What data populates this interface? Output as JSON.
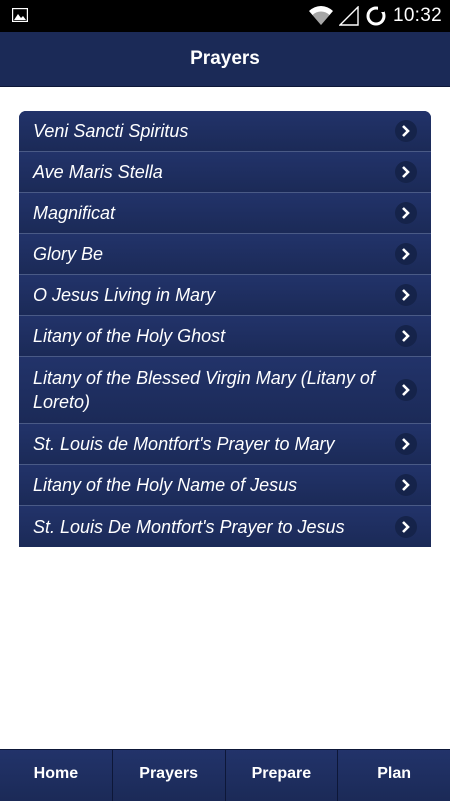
{
  "status_bar": {
    "time": "10:32",
    "icons": [
      "image-notification-icon",
      "wifi-icon",
      "signal-icon",
      "sync-icon"
    ]
  },
  "header": {
    "title": "Prayers"
  },
  "prayers": [
    {
      "label": "Veni Sancti Spiritus"
    },
    {
      "label": "Ave Maris Stella"
    },
    {
      "label": "Magnificat"
    },
    {
      "label": "Glory Be"
    },
    {
      "label": "O Jesus Living in Mary"
    },
    {
      "label": "Litany of the Holy Ghost"
    },
    {
      "label": "Litany of the Blessed Virgin Mary (Litany of Loreto)"
    },
    {
      "label": "St. Louis de Montfort's Prayer to Mary"
    },
    {
      "label": "Litany of the Holy Name of Jesus"
    },
    {
      "label": "St. Louis De Montfort's Prayer to Jesus"
    }
  ],
  "nav": {
    "items": [
      {
        "label": "Home"
      },
      {
        "label": "Prayers"
      },
      {
        "label": "Prepare"
      },
      {
        "label": "Plan"
      }
    ]
  },
  "colors": {
    "primary": "#1b2a57",
    "status_bar": "#000000",
    "text": "#ffffff"
  }
}
